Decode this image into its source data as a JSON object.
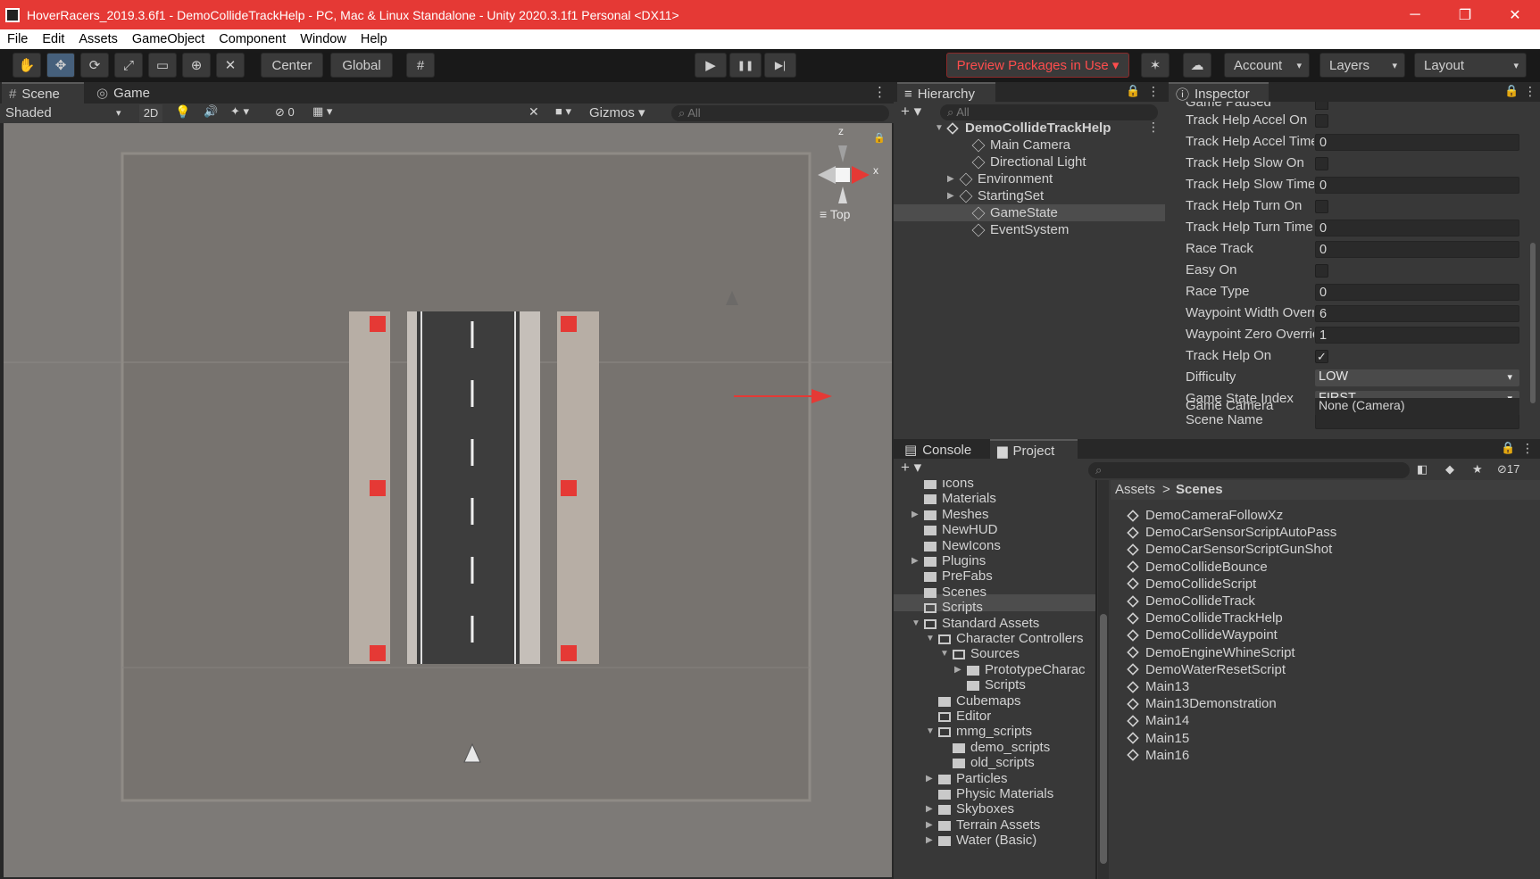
{
  "window": {
    "title": "HoverRacers_2019.3.6f1 - DemoCollideTrackHelp - PC, Mac & Linux Standalone - Unity 2020.3.1f1 Personal <DX11>",
    "minimize": "─",
    "maximize": "❐",
    "close": "✕"
  },
  "menu": [
    "File",
    "Edit",
    "Assets",
    "GameObject",
    "Component",
    "Window",
    "Help"
  ],
  "toolbar": {
    "hand": "✋",
    "move": "✥",
    "rotate": "⟳",
    "scale": "⤢",
    "rect": "▭",
    "transform": "⊕",
    "custom": "✕",
    "pivot": "Center",
    "space": "Global",
    "snap": "#",
    "play": "▶",
    "pause": "❚❚",
    "step": "▶|",
    "packages": "Preview Packages in Use ▾",
    "collab": "✶",
    "cloud": "☁",
    "account": "Account",
    "layers": "Layers",
    "layout": "Layout",
    "caret": "▾"
  },
  "scene": {
    "tab_scene": "Scene",
    "tab_game": "Game",
    "shading": "Shaded",
    "mode2d": "2D",
    "hidden_count": "0",
    "gizmos": "Gizmos",
    "search": "All",
    "axis_z": "z",
    "axis_x": "x",
    "view": "Top",
    "menu": "⋮"
  },
  "hierarchy": {
    "title": "Hierarchy",
    "search": "All",
    "root": "DemoCollideTrackHelp",
    "items": [
      "Main Camera",
      "Directional Light",
      "Environment",
      "StartingSet",
      "GameState",
      "EventSystem"
    ]
  },
  "inspector": {
    "title": "Inspector",
    "cut_top": "Game Paused",
    "cut_bottom": "Game Camera",
    "cut_bottom_value": "None (Camera)",
    "rows": [
      {
        "label": "Track Help Accel On",
        "type": "check",
        "value": ""
      },
      {
        "label": "Track Help Accel Time",
        "type": "field",
        "value": "0"
      },
      {
        "label": "Track Help Slow On",
        "type": "check",
        "value": ""
      },
      {
        "label": "Track Help Slow Time",
        "type": "field",
        "value": "0"
      },
      {
        "label": "Track Help Turn On",
        "type": "check",
        "value": ""
      },
      {
        "label": "Track Help Turn Time",
        "type": "field",
        "value": "0"
      },
      {
        "label": "Race Track",
        "type": "field",
        "value": "0"
      },
      {
        "label": "Easy On",
        "type": "check",
        "value": ""
      },
      {
        "label": "Race Type",
        "type": "field",
        "value": "0"
      },
      {
        "label": "Waypoint Width Override",
        "type": "field",
        "value": "6"
      },
      {
        "label": "Waypoint Zero Override",
        "type": "field",
        "value": "1"
      },
      {
        "label": "Track Help On",
        "type": "check",
        "value": "✓"
      },
      {
        "label": "Difficulty",
        "type": "dropdown",
        "value": "LOW"
      },
      {
        "label": "Game State Index",
        "type": "dropdown",
        "value": "FIRST"
      },
      {
        "label": "Scene Name",
        "type": "field",
        "value": ""
      }
    ]
  },
  "console": {
    "tab": "Console"
  },
  "project": {
    "tab": "Project",
    "hidden_count": "17",
    "breadcrumb_root": "Assets",
    "breadcrumb_sep": ">",
    "breadcrumb_current": "Scenes",
    "tree": [
      {
        "name": "Icons",
        "indent": 0,
        "arrow": "",
        "open": false
      },
      {
        "name": "Materials",
        "indent": 0,
        "arrow": "",
        "open": false
      },
      {
        "name": "Meshes",
        "indent": 0,
        "arrow": "▶",
        "open": false
      },
      {
        "name": "NewHUD",
        "indent": 0,
        "arrow": "",
        "open": false
      },
      {
        "name": "NewIcons",
        "indent": 0,
        "arrow": "",
        "open": false
      },
      {
        "name": "Plugins",
        "indent": 0,
        "arrow": "▶",
        "open": false
      },
      {
        "name": "PreFabs",
        "indent": 0,
        "arrow": "",
        "open": false
      },
      {
        "name": "Scenes",
        "indent": 0,
        "arrow": "",
        "open": false
      },
      {
        "name": "Scripts",
        "indent": 0,
        "arrow": "",
        "open": true
      },
      {
        "name": "Standard Assets",
        "indent": 0,
        "arrow": "▼",
        "open": true
      },
      {
        "name": "Character Controllers",
        "indent": 1,
        "arrow": "▼",
        "open": true
      },
      {
        "name": "Sources",
        "indent": 2,
        "arrow": "▼",
        "open": true
      },
      {
        "name": "PrototypeCharac",
        "indent": 3,
        "arrow": "▶",
        "open": false
      },
      {
        "name": "Scripts",
        "indent": 3,
        "arrow": "",
        "open": false
      },
      {
        "name": "Cubemaps",
        "indent": 1,
        "arrow": "",
        "open": false
      },
      {
        "name": "Editor",
        "indent": 1,
        "arrow": "",
        "open": true
      },
      {
        "name": "mmg_scripts",
        "indent": 1,
        "arrow": "▼",
        "open": true
      },
      {
        "name": "demo_scripts",
        "indent": 2,
        "arrow": "",
        "open": false
      },
      {
        "name": "old_scripts",
        "indent": 2,
        "arrow": "",
        "open": false
      },
      {
        "name": "Particles",
        "indent": 1,
        "arrow": "▶",
        "open": false
      },
      {
        "name": "Physic Materials",
        "indent": 1,
        "arrow": "",
        "open": false
      },
      {
        "name": "Skyboxes",
        "indent": 1,
        "arrow": "▶",
        "open": false
      },
      {
        "name": "Terrain Assets",
        "indent": 1,
        "arrow": "▶",
        "open": false
      },
      {
        "name": "Water (Basic)",
        "indent": 1,
        "arrow": "▶",
        "open": false
      }
    ],
    "scenes": [
      "DemoCameraFollowXz",
      "DemoCarSensorScriptAutoPass",
      "DemoCarSensorScriptGunShot",
      "DemoCollideBounce",
      "DemoCollideScript",
      "DemoCollideTrack",
      "DemoCollideTrackHelp",
      "DemoCollideWaypoint",
      "DemoEngineWhineScript",
      "DemoWaterResetScript",
      "Main13",
      "Main13Demonstration",
      "Main14",
      "Main15",
      "Main16"
    ]
  }
}
